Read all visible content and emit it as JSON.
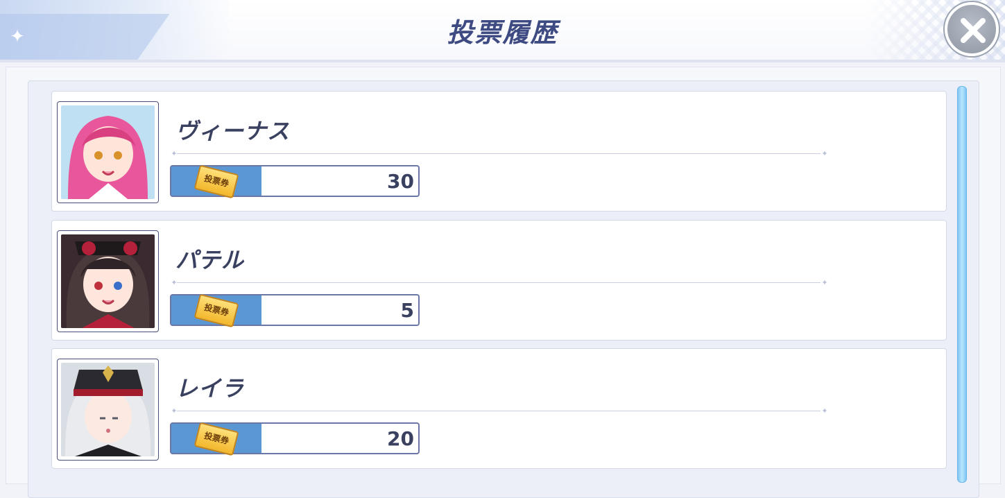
{
  "header": {
    "title": "投票履歴",
    "close_icon": "close-icon"
  },
  "colors": {
    "accent": "#3e4a82",
    "vote_fill": "#5b97d3",
    "scrollbar": "#8fd1f7"
  },
  "votes": [
    {
      "name": "ヴィーナス",
      "ticket_label": "投票券",
      "count": "30",
      "avatar_icon": "character-portrait"
    },
    {
      "name": "パテル",
      "ticket_label": "投票券",
      "count": "5",
      "avatar_icon": "character-portrait"
    },
    {
      "name": "レイラ",
      "ticket_label": "投票券",
      "count": "20",
      "avatar_icon": "character-portrait"
    }
  ]
}
